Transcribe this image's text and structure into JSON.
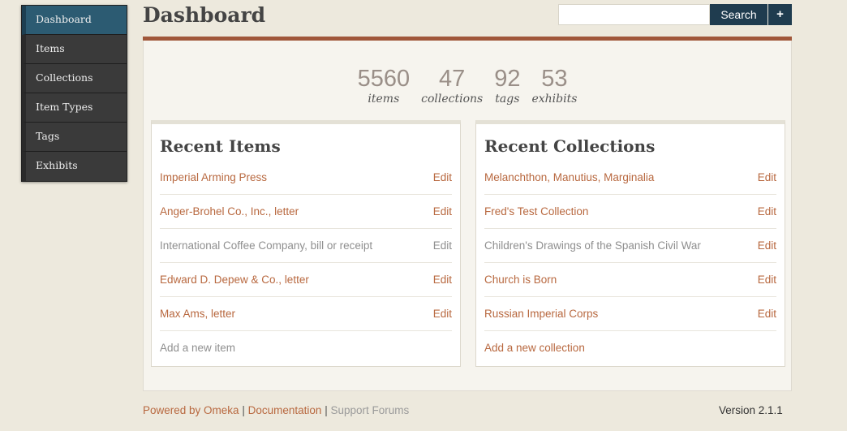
{
  "nav": {
    "items": [
      {
        "label": "Dashboard"
      },
      {
        "label": "Items"
      },
      {
        "label": "Collections"
      },
      {
        "label": "Item Types"
      },
      {
        "label": "Tags"
      },
      {
        "label": "Exhibits"
      }
    ],
    "active": "Dashboard"
  },
  "header": {
    "title": "Dashboard",
    "search_value": "",
    "search_label": "Search",
    "advanced_label": "+"
  },
  "stats": [
    {
      "count": "5560",
      "label": "items"
    },
    {
      "count": "47",
      "label": "collections"
    },
    {
      "count": "92",
      "label": "tags"
    },
    {
      "count": "53",
      "label": "exhibits"
    }
  ],
  "recent_items": {
    "title": "Recent Items",
    "rows": [
      {
        "title": "Imperial Arming Press",
        "edit": "Edit"
      },
      {
        "title": "Anger-Brohel Co., Inc., letter",
        "edit": "Edit"
      },
      {
        "title": "International Coffee Company, bill or receipt",
        "edit": "Edit"
      },
      {
        "title": "Edward D. Depew & Co., letter",
        "edit": "Edit"
      },
      {
        "title": "Max Ams, letter",
        "edit": "Edit"
      }
    ],
    "add_label": "Add a new item"
  },
  "recent_collections": {
    "title": "Recent Collections",
    "rows": [
      {
        "title": "Melanchthon, Manutius, Marginalia",
        "edit": "Edit"
      },
      {
        "title": "Fred's Test Collection",
        "edit": "Edit"
      },
      {
        "title": "Children's Drawings of the Spanish Civil War",
        "edit": "Edit"
      },
      {
        "title": "Church is Born",
        "edit": "Edit"
      },
      {
        "title": "Russian Imperial Corps",
        "edit": "Edit"
      }
    ],
    "add_label": "Add a new collection"
  },
  "footer": {
    "powered": "Powered by Omeka",
    "documentation": "Documentation",
    "support": "Support Forums",
    "separator": "|",
    "version": "Version 2.1.1"
  },
  "colors": {
    "accent": "#b8683f",
    "nav_active": "#2c5b72",
    "search_button": "#1f3c4f",
    "rule": "#a0573a",
    "background": "#ede9dd"
  }
}
